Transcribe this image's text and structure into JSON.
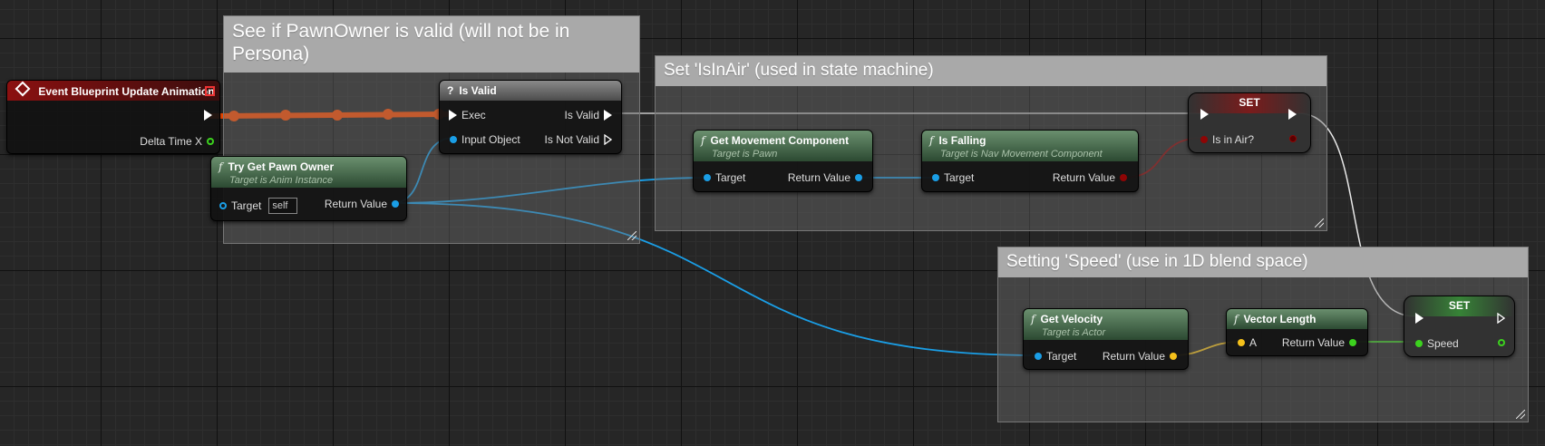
{
  "comments": {
    "pawn_valid": "See if PawnOwner is valid (will not be in Persona)",
    "is_in_air": "Set 'IsInAir' (used in state machine)",
    "speed": "Setting 'Speed' (use in 1D blend space)"
  },
  "nodes": {
    "event_update": {
      "title": "Event Blueprint Update Animation",
      "pin_delta": "Delta Time X"
    },
    "try_get_pawn": {
      "title": "Try Get Pawn Owner",
      "subtitle": "Target is Anim Instance",
      "pin_target": "Target",
      "target_default": "self",
      "pin_return": "Return Value"
    },
    "is_valid": {
      "title": "Is Valid",
      "pin_exec": "Exec",
      "pin_input": "Input Object",
      "pin_valid": "Is Valid",
      "pin_not_valid": "Is Not Valid"
    },
    "get_movement": {
      "title": "Get Movement Component",
      "subtitle": "Target is Pawn",
      "pin_target": "Target",
      "pin_return": "Return Value"
    },
    "is_falling": {
      "title": "Is Falling",
      "subtitle": "Target is Nav Movement Component",
      "pin_target": "Target",
      "pin_return": "Return Value"
    },
    "set_air": {
      "title": "SET",
      "pin_var": "Is in Air?"
    },
    "get_velocity": {
      "title": "Get Velocity",
      "subtitle": "Target is Actor",
      "pin_target": "Target",
      "pin_return": "Return Value"
    },
    "vector_length": {
      "title": "Vector Length",
      "pin_a": "A",
      "pin_return": "Return Value"
    },
    "set_speed": {
      "title": "SET",
      "pin_var": "Speed"
    }
  },
  "colors": {
    "exec_wire": "#ff4d00",
    "object_pin": "#1a9ee6",
    "vector_pin": "#f5c11b",
    "float_pin": "#3cd21e",
    "bool_pin": "#8e0505",
    "event_header": "#8b1010",
    "function_header": "#4b6b50",
    "comment_title": "#a9a9a9"
  },
  "icons": {
    "event": "event-diamond-icon",
    "is_valid": "question-mark-icon",
    "function": "function-f-icon"
  }
}
